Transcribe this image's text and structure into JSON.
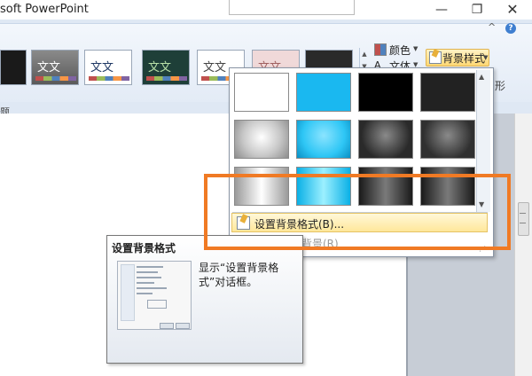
{
  "window": {
    "title": "soft PowerPoint",
    "minimize_glyph": "—",
    "maximize_glyph": "❐",
    "close_glyph": "✕"
  },
  "ribbon": {
    "help_glyph": "?",
    "collapse_glyph": "^",
    "themes": [
      {
        "sample": ""
      },
      {
        "sample": "文文"
      },
      {
        "sample": "文文"
      },
      {
        "sample": "文文"
      },
      {
        "sample": "文文"
      },
      {
        "sample": "文文"
      },
      {
        "sample": ""
      }
    ],
    "colors_label": "颜色",
    "fonts_label": "文体",
    "fonts_icon_glyph": "A",
    "background_styles_label": "背景样式",
    "side_fragment": "形",
    "group_label_fragment": "题",
    "dropdown_arrow": "▼"
  },
  "background_styles_menu": {
    "swatch_colors": [
      "#ffffff",
      "#1ab8f0",
      "#000000",
      "#222222",
      "#c8c8c8",
      "#2ec6f5",
      "#2a2a2a",
      "#303030",
      "#dcdcdc",
      "#33d6fa",
      "#3a3a3a",
      "#404040"
    ],
    "format_background_label": "设置背景格式(B)...",
    "reset_background_label": "背景(R)",
    "scroll_up_glyph": "▲",
    "scroll_down_glyph": "▼",
    "resize_glyph": "⋰"
  },
  "tooltip": {
    "title": "设置背景格式",
    "description": "显示“设置背景格式”对话框。"
  },
  "colors": {
    "highlight": "#f07a24",
    "hover_fill": "#ffe79a"
  }
}
